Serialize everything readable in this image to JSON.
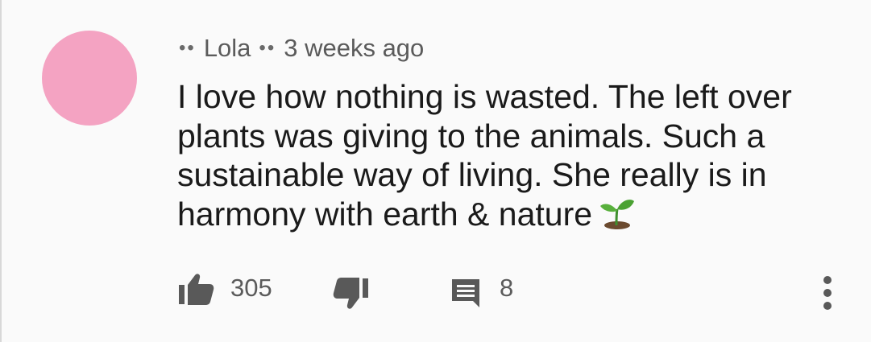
{
  "comment": {
    "author": "Lola",
    "timestamp": "3 weeks ago",
    "text": "I love how nothing is wasted. The left over plants was giving to the animals. Such a sustainable way of living. She really is in harmony with earth & nature",
    "emoji": "seedling-icon",
    "likes": "305",
    "replies": "8"
  },
  "colors": {
    "avatar": "#f4a3c2",
    "meta_text": "#5b5b5b",
    "icon": "#595959",
    "background": "#fafafa"
  },
  "icons": {
    "like": "thumbs-up-icon",
    "dislike": "thumbs-down-icon",
    "reply": "comment-icon",
    "more": "more-vert-icon"
  }
}
